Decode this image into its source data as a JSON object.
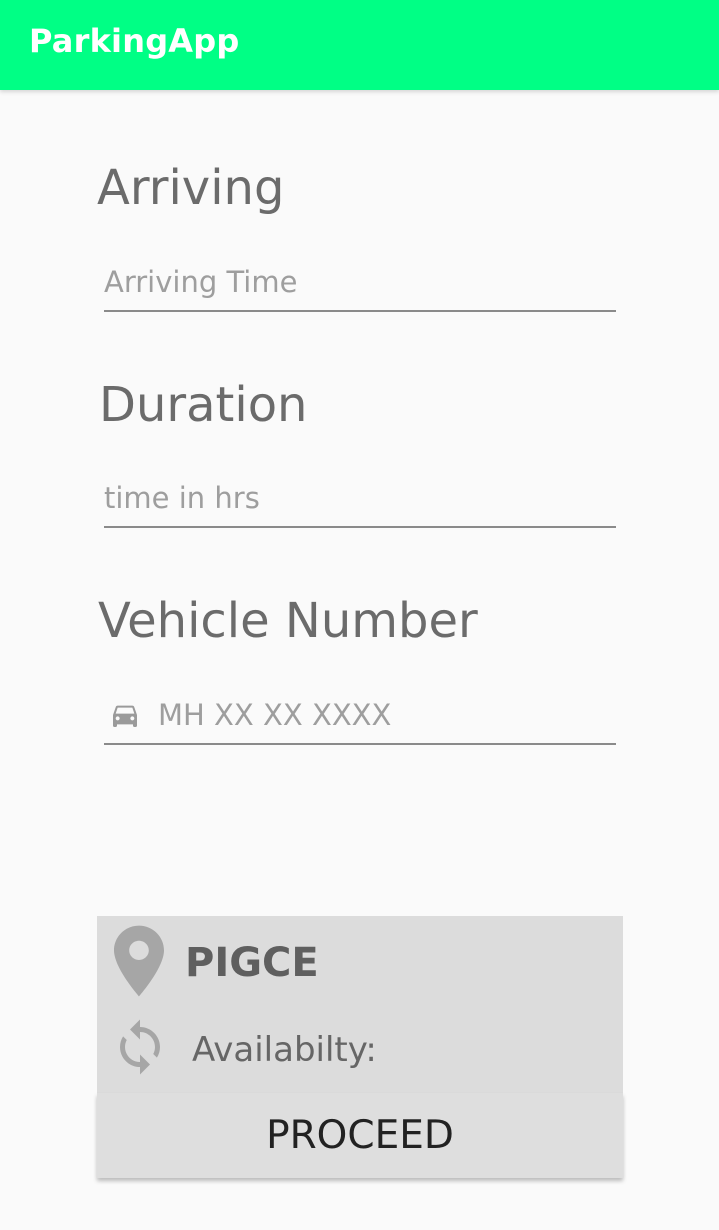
{
  "app_bar": {
    "title": "ParkingApp",
    "color": "#00ff85"
  },
  "form": {
    "arriving": {
      "label": "Arriving",
      "placeholder": "Arriving Time",
      "value": ""
    },
    "duration": {
      "label": "Duration",
      "placeholder": "time in hrs",
      "value": ""
    },
    "vehicle": {
      "label": "Vehicle Number",
      "placeholder": "MH XX XX XXXX",
      "value": "",
      "icon": "car-icon"
    }
  },
  "place_card": {
    "name": "PIGCE",
    "availability_label": "Availabilty:",
    "location_icon": "location-pin-icon",
    "sync_icon": "sync-icon"
  },
  "actions": {
    "proceed_label": "PROCEED"
  }
}
